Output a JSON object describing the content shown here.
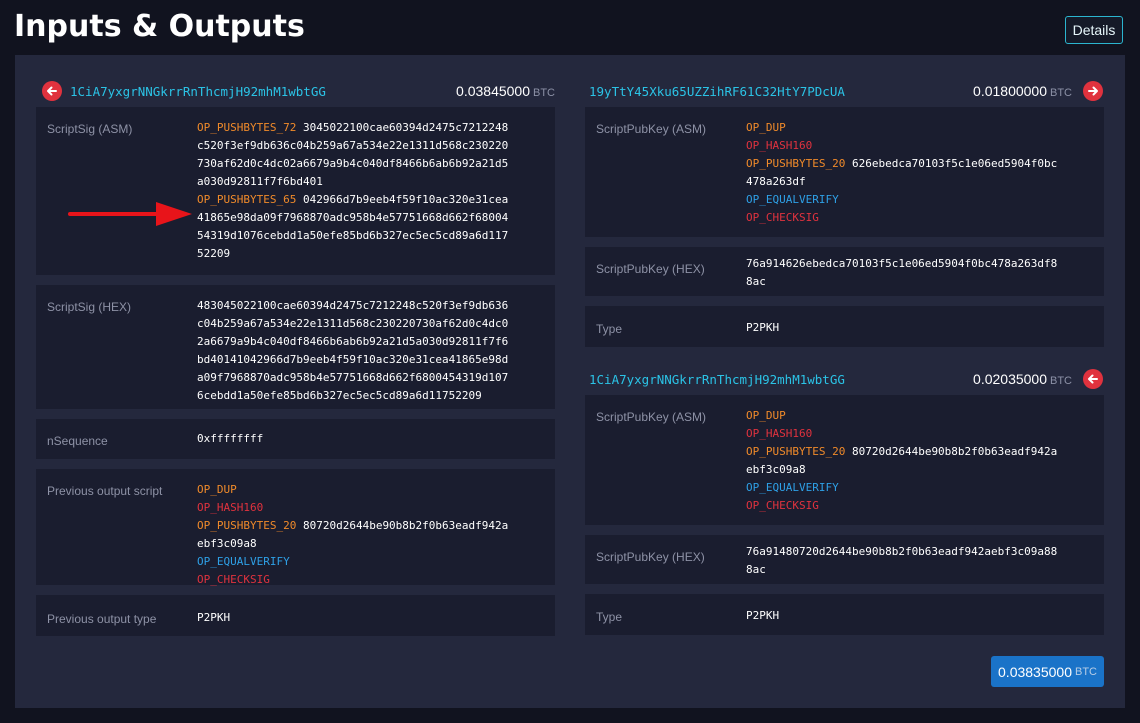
{
  "page": {
    "title": "Inputs & Outputs",
    "details_label": "Details"
  },
  "input": {
    "address": "1CiA7yxgrNNGkrrRnThcmjH92mhM1wbtGG",
    "amount": "0.03845000",
    "unit": "BTC",
    "scriptsig_asm_label": "ScriptSig (ASM)",
    "scriptsig_asm": {
      "op1": "OP_PUSHBYTES_72",
      "data1_l1": "3045022100cae60394d2475c7212248",
      "data1_l2": "c520f3ef9db636c04b259a67a534e22e1311d568c230220",
      "data1_l3": "730af62d0c4dc02a6679a9b4c040df8466b6ab6b92a21d5",
      "data1_l4": "a030d92811f7f6bd401",
      "op2": "OP_PUSHBYTES_65",
      "data2_l1": "042966d7b9eeb4f59f10ac320e31cea",
      "data2_l2": "41865e98da09f7968870adc958b4e57751668d662f68004",
      "data2_l3": "54319d1076cebdd1a50efe85bd6b327ec5ec5cd89a6d117",
      "data2_l4": "52209"
    },
    "scriptsig_hex_label": "ScriptSig (HEX)",
    "scriptsig_hex_lines": [
      "483045022100cae60394d2475c7212248c520f3ef9db636",
      "c04b259a67a534e22e1311d568c230220730af62d0c4dc0",
      "2a6679a9b4c040df8466b6ab6b92a21d5a030d92811f7f6",
      "bd40141042966d7b9eeb4f59f10ac320e31cea41865e98d",
      "a09f7968870adc958b4e57751668d662f6800454319d107",
      "6cebdd1a50efe85bd6b327ec5ec5cd89a6d11752209"
    ],
    "nsequence_label": "nSequence",
    "nsequence": "0xffffffff",
    "prev_script_label": "Previous output script",
    "prev_script": {
      "op_dup": "OP_DUP",
      "op_hash160": "OP_HASH160",
      "op_push": "OP_PUSHBYTES_20",
      "hash_l1": "80720d2644be90b8b2f0b63eadf942a",
      "hash_l2": "ebf3c09a8",
      "op_eqv": "OP_EQUALVERIFY",
      "op_cs": "OP_CHECKSIG"
    },
    "prev_type_label": "Previous output type",
    "prev_type": "P2PKH"
  },
  "outputs": [
    {
      "address": "19yTtY45Xku65UZZihRF61C32HtY7PDcUA",
      "amount": "0.01800000",
      "unit": "BTC",
      "asm_label": "ScriptPubKey (ASM)",
      "asm": {
        "op_dup": "OP_DUP",
        "op_hash160": "OP_HASH160",
        "op_push": "OP_PUSHBYTES_20",
        "hash_l1": "626ebedca70103f5c1e06ed5904f0bc",
        "hash_l2": "478a263df",
        "op_eqv": "OP_EQUALVERIFY",
        "op_cs": "OP_CHECKSIG"
      },
      "hex_label": "ScriptPubKey (HEX)",
      "hex_l1": "76a914626ebedca70103f5c1e06ed5904f0bc478a263df8",
      "hex_l2": "8ac",
      "type_label": "Type",
      "type": "P2PKH"
    },
    {
      "address": "1CiA7yxgrNNGkrrRnThcmjH92mhM1wbtGG",
      "amount": "0.02035000",
      "unit": "BTC",
      "asm_label": "ScriptPubKey (ASM)",
      "asm": {
        "op_dup": "OP_DUP",
        "op_hash160": "OP_HASH160",
        "op_push": "OP_PUSHBYTES_20",
        "hash_l1": "80720d2644be90b8b2f0b63eadf942a",
        "hash_l2": "ebf3c09a8",
        "op_eqv": "OP_EQUALVERIFY",
        "op_cs": "OP_CHECKSIG"
      },
      "hex_label": "ScriptPubKey (HEX)",
      "hex_l1": "76a91480720d2644be90b8b2f0b63eadf942aebf3c09a88",
      "hex_l2": "8ac",
      "type_label": "Type",
      "type": "P2PKH"
    }
  ],
  "total": {
    "amount": "0.03835000",
    "unit": "BTC"
  },
  "colors": {
    "accent": "#2bc3e6",
    "op_orange": "#f08a2a",
    "op_red": "#e0323e",
    "op_blue": "#2ea0e6",
    "total_bg": "#1a73c8"
  }
}
